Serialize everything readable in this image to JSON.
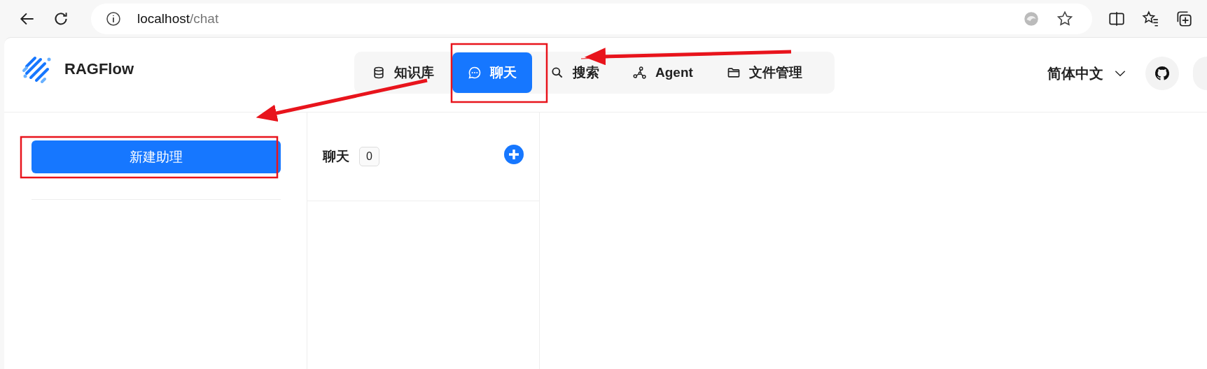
{
  "browser": {
    "url_host": "localhost",
    "url_path": "/chat"
  },
  "header": {
    "brand": "RAGFlow",
    "language": "简体中文"
  },
  "nav_tabs": [
    {
      "label": "知识库",
      "kind": "database",
      "selected": false
    },
    {
      "label": "聊天",
      "kind": "chat",
      "selected": true
    },
    {
      "label": "搜索",
      "kind": "search",
      "selected": false
    },
    {
      "label": "Agent",
      "kind": "graph",
      "selected": false
    },
    {
      "label": "文件管理",
      "kind": "folder",
      "selected": false
    }
  ],
  "sidebar": {
    "new_button": "新建助理"
  },
  "chat_list": {
    "title": "聊天",
    "count": "0"
  }
}
